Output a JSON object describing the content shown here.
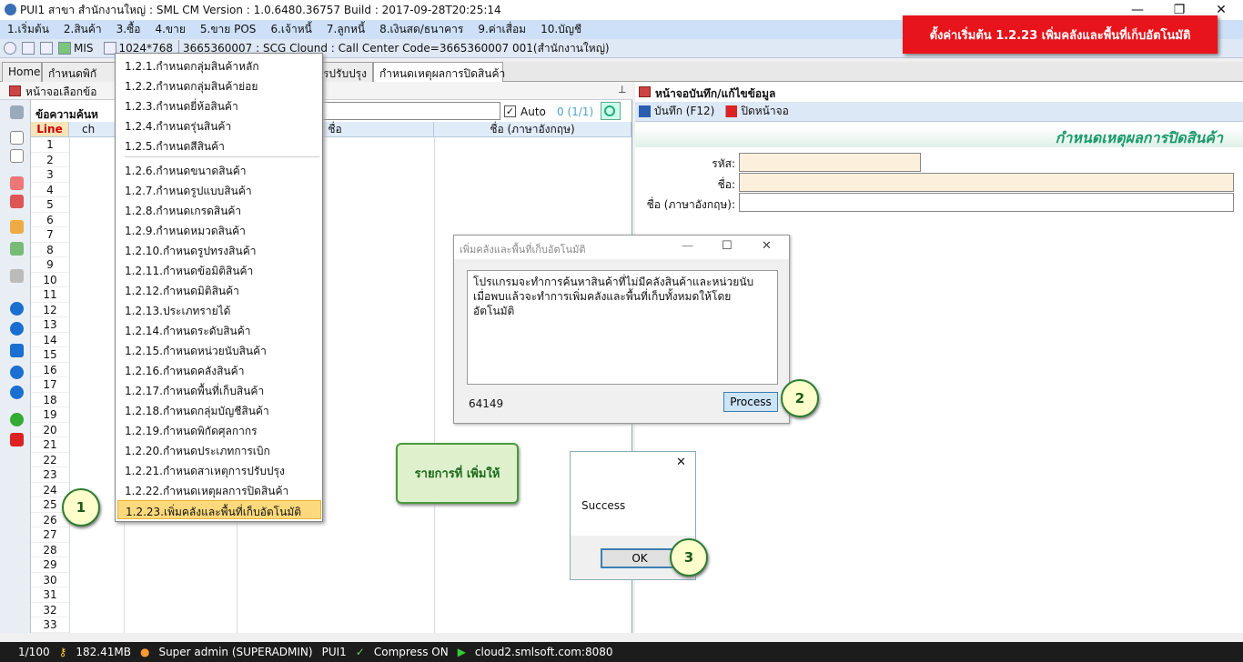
{
  "window": {
    "title": "PUI1 สาขา สำนักงานใหญ่ : SML CM Version : 1.0.6480.36757  Build : 2017-09-28T20:25:14",
    "minimize": "—",
    "restore": "❐",
    "close": "✕"
  },
  "menu": [
    "1.เริ่มต้น",
    "2.สินค้า",
    "3.ซื้อ",
    "4.ขาย",
    "5.ขาย POS",
    "6.เจ้าหนี้",
    "7.ลูกหนี้",
    "8.เงินสด/ธนาคาร",
    "9.ค่าเสื่อม",
    "10.บัญชี"
  ],
  "toolbar": {
    "mis": "MIS",
    "resolution": "1024*768",
    "info": "3665360007 : SCG Clound : Call Center Code=3665360007 001(สำนักงานใหญ่)"
  },
  "banner": "ตั้งค่าเริ่มต้น  1.2.23  เพิ่มคลังและพื้นที่เก็บอัตโนมัติ",
  "tabs": [
    "Home",
    "กำหนดพิกั",
    "การปรับปรุง",
    "กำหนดเหตุผลการปิดสินค้า"
  ],
  "left_panel": {
    "header": "หน้าจอเลือกข้อ",
    "search_label": "ข้อความค้นห",
    "auto_label": "Auto",
    "pager": "0 (1/1)",
    "columns": [
      "Line",
      "ch",
      "ชื่อ",
      "ชื่อ (ภาษาอังกฤษ)"
    ],
    "rows": [
      "1",
      "2",
      "3",
      "4",
      "5",
      "6",
      "7",
      "8",
      "9",
      "10",
      "11",
      "12",
      "13",
      "14",
      "15",
      "16",
      "17",
      "18",
      "19",
      "20",
      "21",
      "22",
      "23",
      "24",
      "25",
      "26",
      "27",
      "28",
      "29",
      "30",
      "31",
      "32",
      "33"
    ]
  },
  "dropdown": {
    "group1": [
      "1.2.1.กำหนดกลุ่มสินค้าหลัก",
      "1.2.2.กำหนดกลุ่มสินค้าย่อย",
      "1.2.3.กำหนดยี่ห้อสินค้า",
      "1.2.4.กำหนดรุ่นสินค้า",
      "1.2.5.กำหนดสีสินค้า"
    ],
    "group2": [
      "1.2.6.กำหนดขนาดสินค้า",
      "1.2.7.กำหนดรูปแบบสินค้า",
      "1.2.8.กำหนดเกรดสินค้า",
      "1.2.9.กำหนดหมวดสินค้า",
      "1.2.10.กำหนดรูปทรงสินค้า",
      "1.2.11.กำหนดข้อมิติสินค้า",
      "1.2.12.กำหนดมิติสินค้า",
      "1.2.13.ประเภทรายได้",
      "1.2.14.กำหนดระดับสินค้า",
      "1.2.15.กำหนดหน่วยนับสินค้า",
      "1.2.16.กำหนดคลังสินค้า",
      "1.2.17.กำหนดพื้นที่เก็บสินค้า",
      "1.2.18.กำหนดกลุ่มบัญชีสินค้า",
      "1.2.19.กำหนดพิกัดศุลกากร",
      "1.2.20.กำหนดประเภทการเบิก",
      "1.2.21.กำหนดสาเหตุการปรับปรุง",
      "1.2.22.กำหนดเหตุผลการปิดสินค้า"
    ],
    "selected": "1.2.23.เพิ่มคลังและพื้นที่เก็บอัตโนมัติ"
  },
  "right_panel": {
    "header": "หน้าจอบันทึก/แก้ไขข้อมูล",
    "save": "บันทึก (F12)",
    "close": "ปิดหน้าจอ",
    "form_title": "กำหนดเหตุผลการปิดสินค้า",
    "labels": {
      "code": "รหัส:",
      "name": "ชื่อ:",
      "name_en": "ชื่อ (ภาษาอังกฤษ):"
    }
  },
  "dialog": {
    "title": "เพิ่มคลังและพื้นที่เก็บอัตโนมัติ",
    "text": "โปรแกรมจะทำการค้นหาสินค้าที่ไม่มีคลังสินค้าและหน่วยนับ เมื่อพบแล้วจะทำการเพิ่มคลังและพื้นที่เก็บทั้งหมดให้โดยอัตโนมัติ",
    "count": "64149",
    "process": "Process"
  },
  "note": "รายการที่ เพิ่มให้",
  "msgbox": {
    "text": "Success",
    "ok": "OK",
    "close": "✕"
  },
  "callouts": [
    "1",
    "2",
    "3"
  ],
  "statusbar": {
    "page": "1/100",
    "memory": "182.41MB",
    "user": "Super admin (SUPERADMIN)",
    "branch": "PUI1",
    "compress": "Compress ON",
    "server": "cloud2.smlsoft.com:8080"
  },
  "colors": {
    "accent": "#e8141b",
    "title_green": "#1a9a6a",
    "highlight": "#fbd97c"
  }
}
